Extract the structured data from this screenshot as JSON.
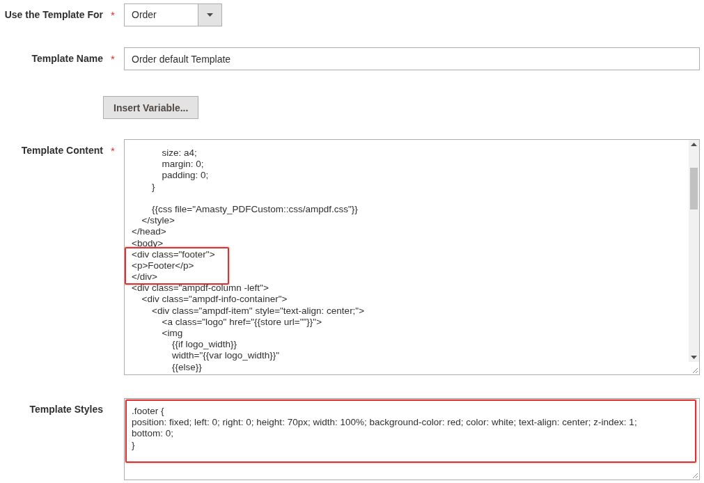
{
  "fields": [
    {
      "kind": "select",
      "label": "Use the Template For",
      "required_mark": "*",
      "value": "Order"
    },
    {
      "kind": "text",
      "label": "Template Name",
      "required_mark": "*",
      "value": "Order default Template"
    },
    {
      "kind": "button",
      "label": "Insert Variable..."
    },
    {
      "kind": "code",
      "label": "Template Content",
      "required_mark": "*",
      "lines": [
        {
          "kind": "group",
          "children": [
            {
              "kind": "group",
              "children": [
                {
                  "kind": "group",
                  "children": [
                    {
                      "kind": "line",
                      "text": "size: a4;"
                    },
                    {
                      "kind": "line",
                      "text": "margin: 0;"
                    },
                    {
                      "kind": "line",
                      "text": "padding: 0;"
                    }
                  ]
                },
                {
                  "kind": "line",
                  "text": "}"
                },
                {
                  "kind": "blank"
                },
                {
                  "kind": "line",
                  "text": "{{css file=\"Amasty_PDFCustom::css/ampdf.css\"}}"
                }
              ]
            },
            {
              "kind": "line",
              "text": "</style>"
            }
          ]
        },
        {
          "kind": "line",
          "text": "</head>"
        },
        {
          "kind": "line",
          "text": "<body>"
        },
        {
          "kind": "highlight",
          "children": [
            {
              "kind": "line",
              "text": "<div class=\"footer\">"
            },
            {
              "kind": "line",
              "text": "<p>Footer</p>"
            },
            {
              "kind": "line",
              "text": "</div>"
            }
          ]
        },
        {
          "kind": "line",
          "text": "<div class=\"ampdf-column -left\">",
          "children": [
            {
              "kind": "line",
              "text": "<div class=\"ampdf-info-container\">",
              "children": [
                {
                  "kind": "line",
                  "text": "<div class=\"ampdf-item\" style=\"text-align: center;\">",
                  "children": [
                    {
                      "kind": "line",
                      "text": "<a class=\"logo\" href=\"{{store url=\"\"}}\">"
                    },
                    {
                      "kind": "line",
                      "text": "<img",
                      "children": [
                        {
                          "kind": "line",
                          "text": "{{if logo_width}}"
                        },
                        {
                          "kind": "line",
                          "text": "width=\"{{var logo_width}}\""
                        },
                        {
                          "kind": "line",
                          "text": "{{else}}"
                        }
                      ]
                    }
                  ]
                }
              ]
            }
          ]
        }
      ]
    },
    {
      "kind": "styles",
      "label": "Template Styles",
      "highlighted": true,
      "lines": [
        ".footer {",
        "position: fixed; left: 0; right: 0; height: 70px; width: 100%; background-color: red; color: white; text-align: center; z-index: 1;",
        "bottom: 0;",
        "}"
      ]
    }
  ]
}
